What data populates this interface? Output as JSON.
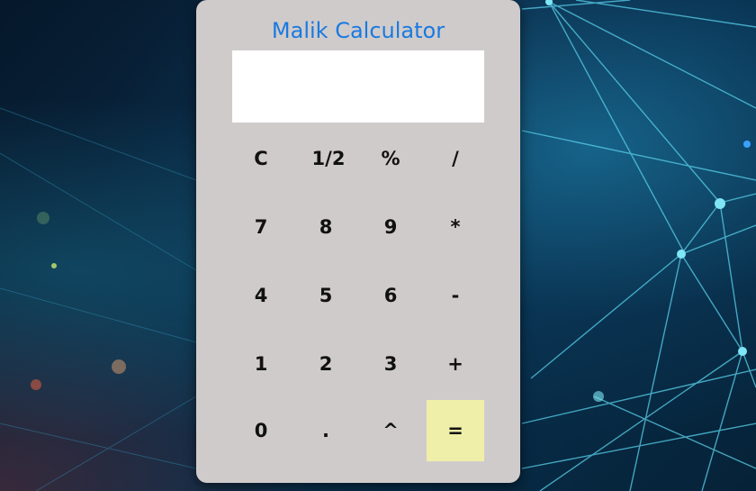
{
  "app": {
    "title": "Malik Calculator"
  },
  "display": {
    "value": ""
  },
  "keys": {
    "clear": "C",
    "half": "1/2",
    "percent": "%",
    "divide": "/",
    "seven": "7",
    "eight": "8",
    "nine": "9",
    "multiply": "*",
    "four": "4",
    "five": "5",
    "six": "6",
    "subtract": "-",
    "one": "1",
    "two": "2",
    "three": "3",
    "add": "+",
    "zero": "0",
    "decimal": ".",
    "power": "^",
    "equals": "="
  },
  "colors": {
    "title": "#1a7ae0",
    "panel": "#d0cbcb",
    "display_bg": "#ffffff",
    "equals_bg": "#f0efa9",
    "background": "#0a2a45"
  }
}
